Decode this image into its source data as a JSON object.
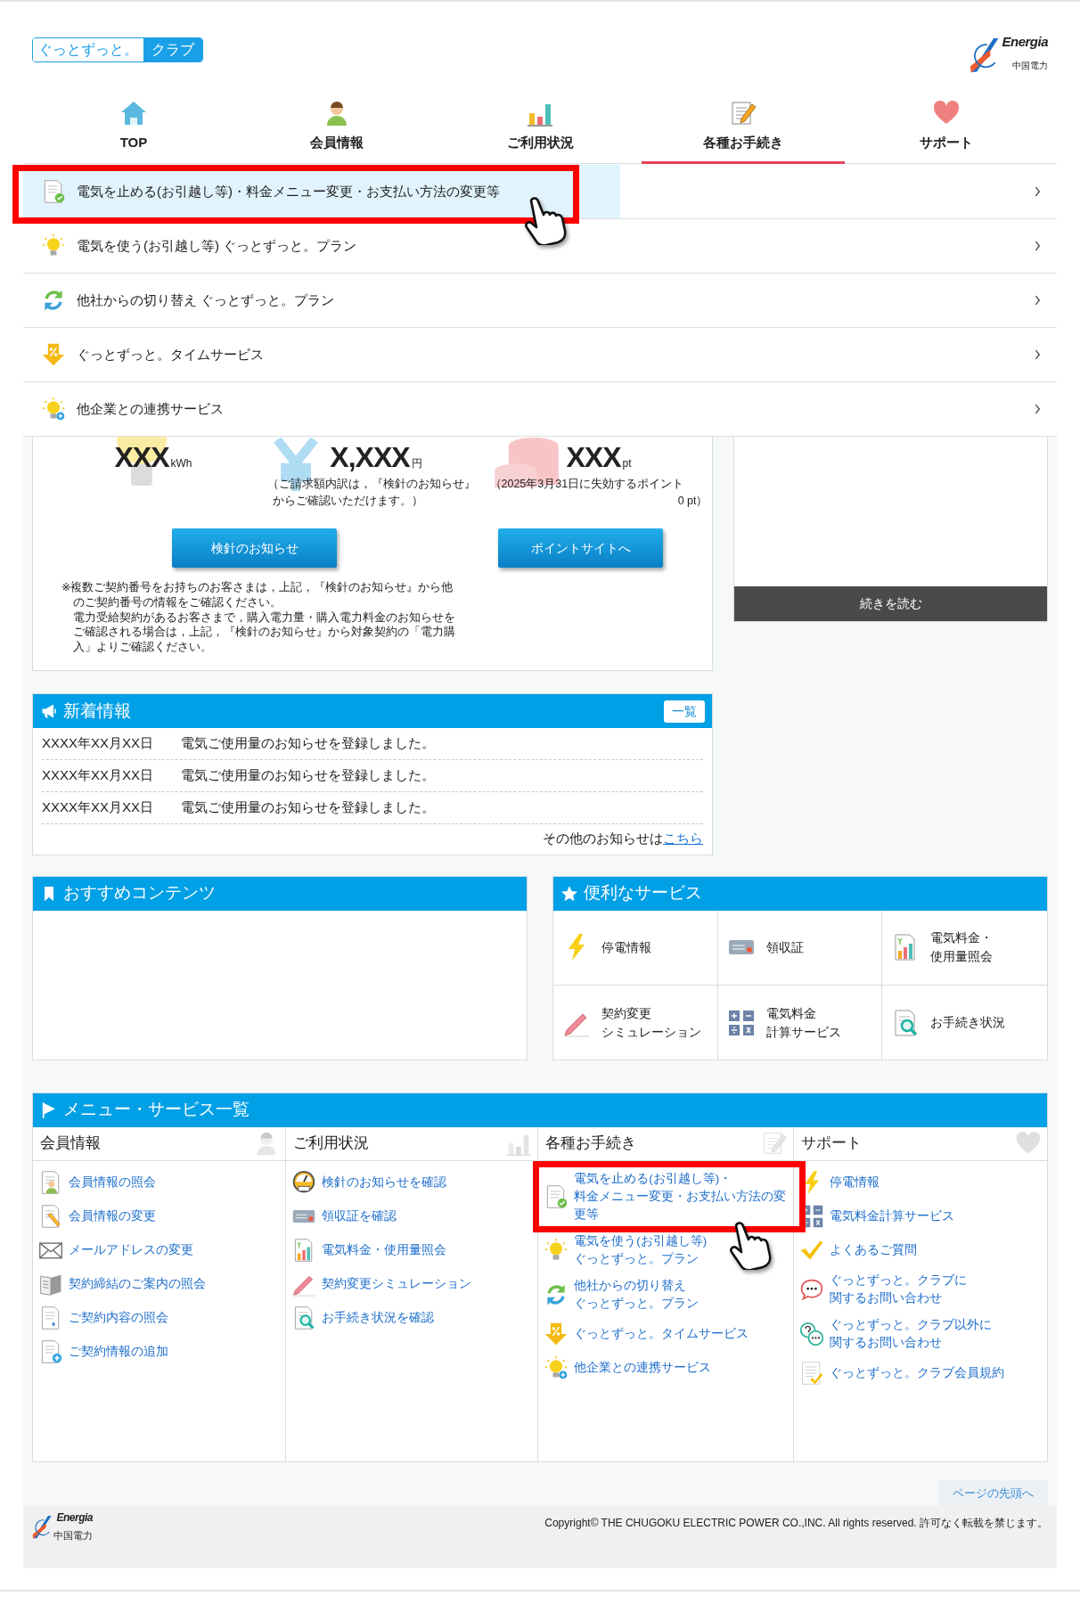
{
  "header": {
    "club_logo": {
      "left": "ぐっとずっと。",
      "right": "クラブ"
    },
    "company_logo": {
      "wordmark": "Energia",
      "name": "中国電力"
    }
  },
  "nav": [
    {
      "label": "TOP",
      "selected": false
    },
    {
      "label": "会員情報",
      "selected": false
    },
    {
      "label": "ご利用状況",
      "selected": false
    },
    {
      "label": "各種お手続き",
      "selected": true
    },
    {
      "label": "サポート",
      "selected": false
    }
  ],
  "dropdown": [
    {
      "label": "電気を止める(お引越し等)・料金メニュー変更・お支払い方法の変更等",
      "hovered": true,
      "callout": true
    },
    {
      "label": "電気を使う(お引越し等) ぐっとずっと。プラン",
      "hovered": false,
      "callout": false
    },
    {
      "label": "他社からの切り替え ぐっとずっと。プラン",
      "hovered": false,
      "callout": false
    },
    {
      "label": "ぐっとずっと。タイムサービス",
      "hovered": false,
      "callout": false
    },
    {
      "label": "他企業との連携サービス",
      "hovered": false,
      "callout": false
    }
  ],
  "usage": {
    "figures": [
      {
        "value": "XXX",
        "unit": "kWh"
      },
      {
        "value": "X,XXX",
        "unit": "円",
        "notes": [
          "（ご請求額内訳は，『検針のお知らせ』",
          "からご確認いただけます。）"
        ]
      },
      {
        "value": "XXX",
        "unit": "pt",
        "notes": [
          "（2025年3月31日に失効するポイント",
          "0 pt）"
        ]
      }
    ],
    "buttons": [
      "検針のお知らせ",
      "ポイントサイトへ"
    ],
    "notes": [
      "※複数ご契約番号をお持ちのお客さまは，上記，『検針のお知らせ』から他のご契約番号の情報をご確認ください。",
      "電力受給契約があるお客さまで，購入電力量・購入電力料金のお知らせをご確認される場合は，上記，『検針のお知らせ』から対象契約の「電力購入」よりご確認ください。"
    ]
  },
  "right_panel": {
    "button": "続きを読む"
  },
  "news": {
    "title": "新着情報",
    "button": "一覧",
    "rows": [
      {
        "date": "XXXX年XX月XX日",
        "text": "電気ご使用量のお知らせを登録しました。"
      },
      {
        "date": "XXXX年XX月XX日",
        "text": "電気ご使用量のお知らせを登録しました。"
      },
      {
        "date": "XXXX年XX月XX日",
        "text": "電気ご使用量のお知らせを登録しました。"
      }
    ],
    "more_text": "その他のお知らせは",
    "more_link": "こちら"
  },
  "recommended": {
    "title": "おすすめコンテンツ"
  },
  "services": {
    "title": "便利なサービス",
    "items": [
      {
        "lines": [
          "停電情報"
        ]
      },
      {
        "lines": [
          "領収証"
        ]
      },
      {
        "lines": [
          "電気料金・",
          "使用量照会"
        ]
      },
      {
        "lines": [
          "契約変更",
          "シミュレーション"
        ]
      },
      {
        "lines": [
          "電気料金",
          "計算サービス"
        ]
      },
      {
        "lines": [
          "お手続き状況"
        ]
      }
    ]
  },
  "menu": {
    "title": "メニュー・サービス一覧",
    "columns": [
      {
        "title": "会員情報",
        "items": [
          {
            "lines": [
              "会員情報の照会"
            ],
            "callout": false
          },
          {
            "lines": [
              "会員情報の変更"
            ],
            "callout": false
          },
          {
            "lines": [
              "メールアドレスの変更"
            ],
            "callout": false
          },
          {
            "lines": [
              "契約締結のご案内の照会"
            ],
            "callout": false
          },
          {
            "lines": [
              "ご契約内容の照会"
            ],
            "callout": false
          },
          {
            "lines": [
              "ご契約情報の追加"
            ],
            "callout": false
          }
        ]
      },
      {
        "title": "ご利用状況",
        "items": [
          {
            "lines": [
              "検針のお知らせを確認"
            ],
            "callout": false
          },
          {
            "lines": [
              "領収証を確認"
            ],
            "callout": false
          },
          {
            "lines": [
              "電気料金・使用量照会"
            ],
            "callout": false
          },
          {
            "lines": [
              "契約変更シミュレーション"
            ],
            "callout": false
          },
          {
            "lines": [
              "お手続き状況を確認"
            ],
            "callout": false
          }
        ]
      },
      {
        "title": "各種お手続き",
        "items": [
          {
            "lines": [
              "電気を止める(お引越し等)・",
              "料金メニュー変更・お支払い方法の変",
              "更等"
            ],
            "callout": true
          },
          {
            "lines": [
              "電気を使う(お引越し等)",
              "ぐっとずっと。プラン"
            ],
            "callout": false
          },
          {
            "lines": [
              "他社からの切り替え",
              "ぐっとずっと。プラン"
            ],
            "callout": false
          },
          {
            "lines": [
              "ぐっとずっと。タイムサービス"
            ],
            "callout": false
          },
          {
            "lines": [
              "他企業との連携サービス"
            ],
            "callout": false
          }
        ]
      },
      {
        "title": "サポート",
        "items": [
          {
            "lines": [
              "停電情報"
            ],
            "callout": false
          },
          {
            "lines": [
              "電気料金計算サービス"
            ],
            "callout": false
          },
          {
            "lines": [
              "よくあるご質問"
            ],
            "callout": false
          },
          {
            "lines": [
              "ぐっとずっと。クラブに",
              "関するお問い合わせ"
            ],
            "callout": false
          },
          {
            "lines": [
              "ぐっとずっと。クラブ以外に",
              "関するお問い合わせ"
            ],
            "callout": false
          },
          {
            "lines": [
              "ぐっとずっと。クラブ会員規約"
            ],
            "callout": false
          }
        ]
      }
    ]
  },
  "back_to_top": "ページの先頭へ",
  "footer": {
    "wordmark": "Energia",
    "name": "中国電力",
    "copyright": "Copyright© THE CHUGOKU ELECTRIC POWER CO.,INC. All rights reserved. 許可なく転載を禁じます。"
  }
}
